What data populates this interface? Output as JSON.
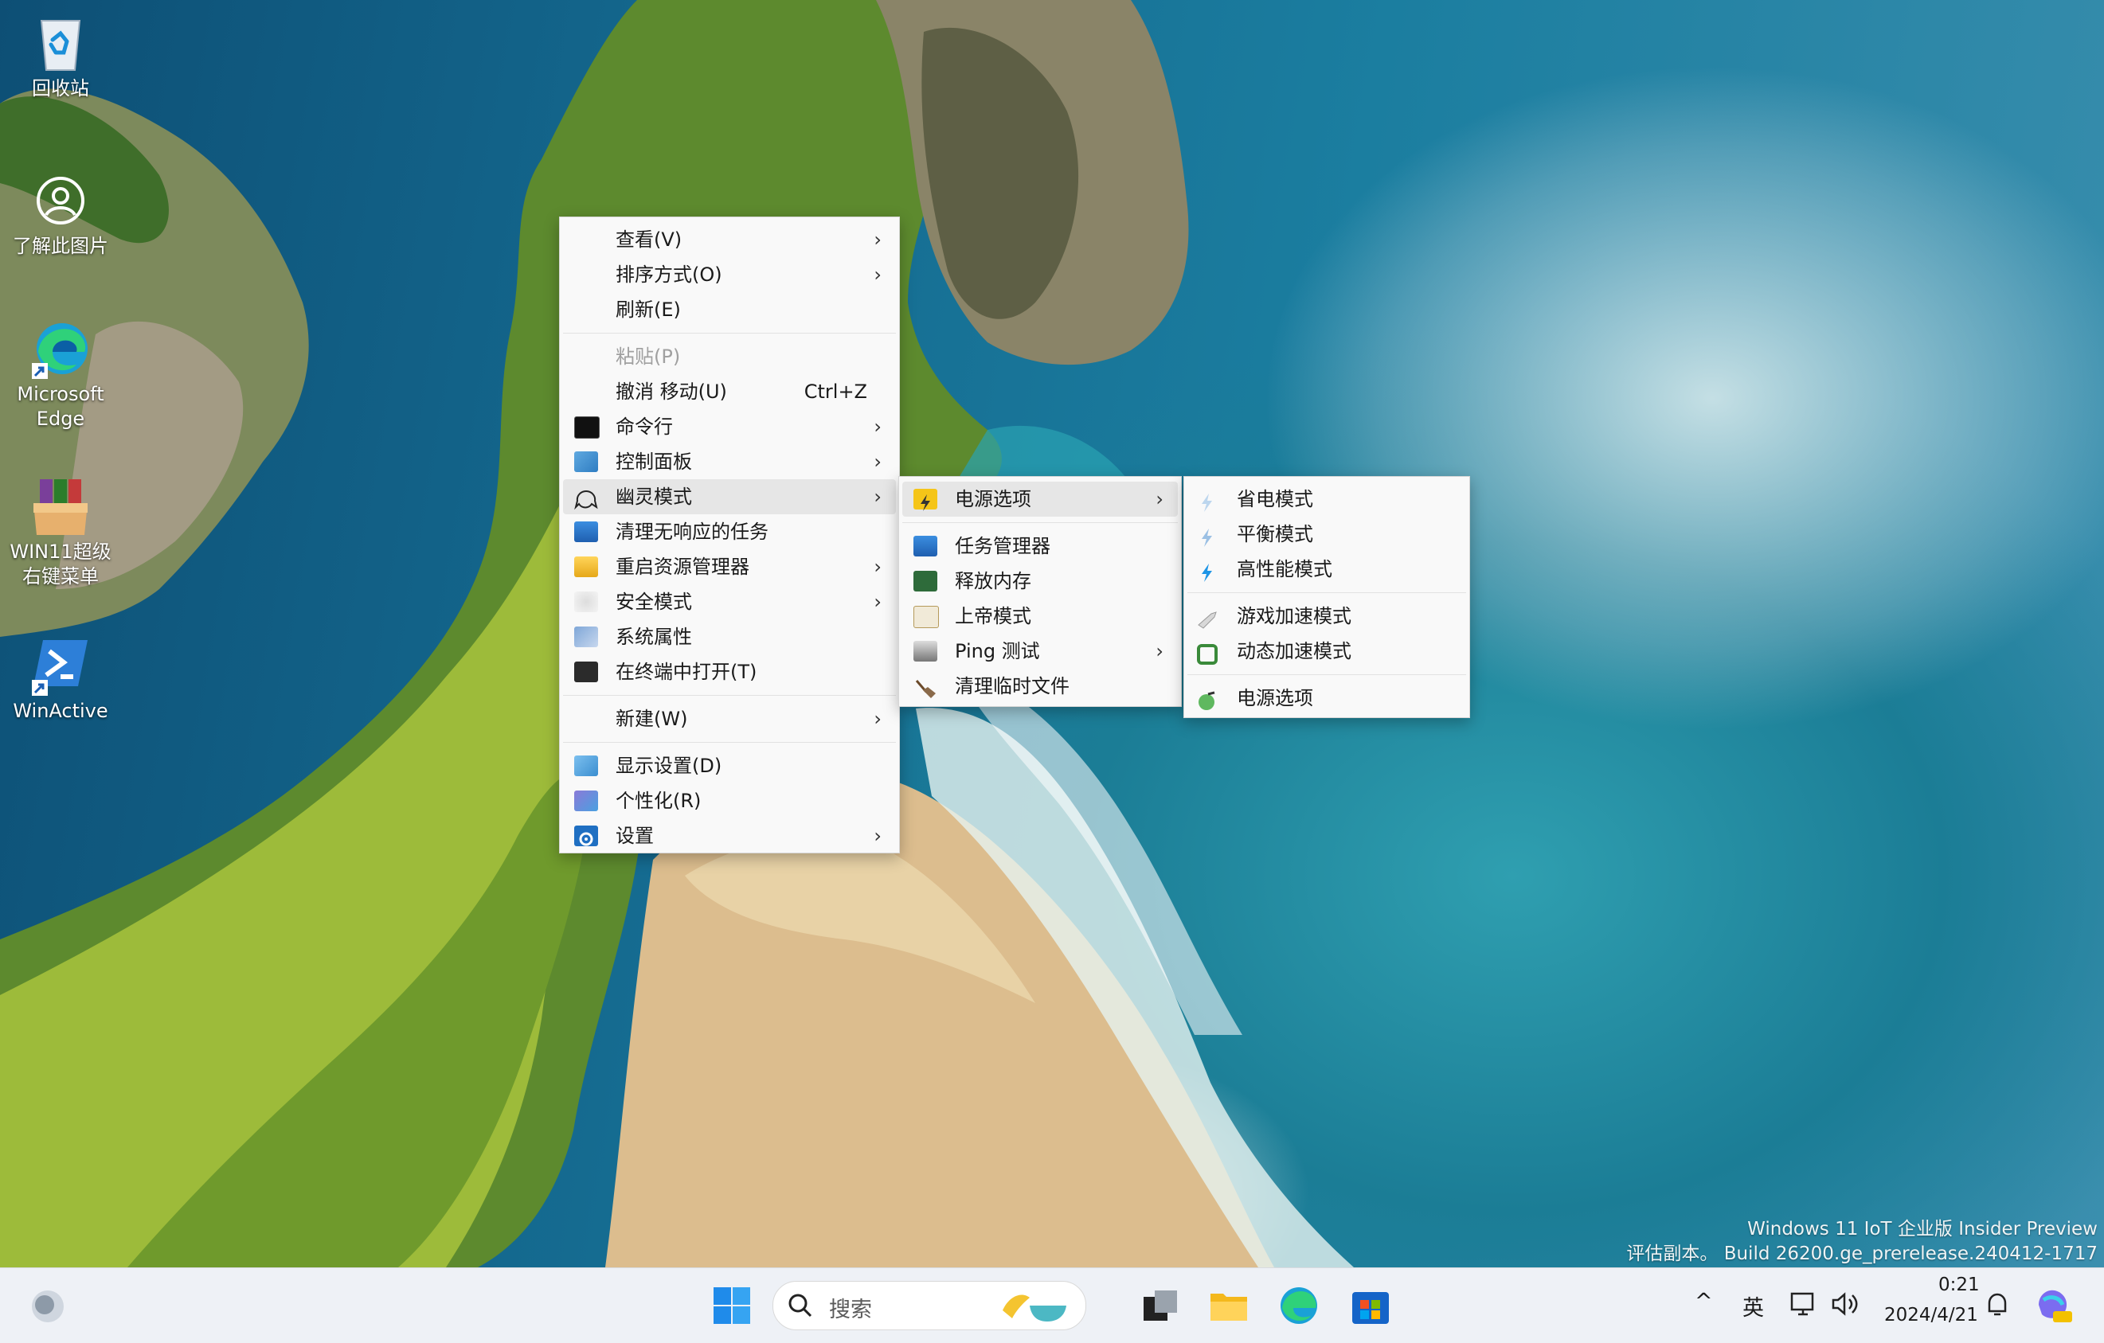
{
  "desktop_icons": [
    {
      "name": "recycle-bin",
      "label": "回收站",
      "icon": "recycle-bin-icon"
    },
    {
      "name": "learn-about-picture",
      "label": "了解此图片",
      "icon": "camera-icon"
    },
    {
      "name": "microsoft-edge",
      "label_line1": "Microsoft",
      "label_line2": "Edge",
      "icon": "edge-icon"
    },
    {
      "name": "win11-context-menu",
      "label_line1": "WIN11超级",
      "label_line2": "右键菜单",
      "icon": "winrar-box-icon"
    },
    {
      "name": "winactive",
      "label": "WinActive",
      "icon": "powershell-icon"
    }
  ],
  "context_menu": {
    "view": "查看(V)",
    "sort": "排序方式(O)",
    "refresh": "刷新(E)",
    "paste": "粘贴(P)",
    "undo": "撤消 移动(U)",
    "undo_shortcut": "Ctrl+Z",
    "cmd": "命令行",
    "control_panel": "控制面板",
    "ghost_mode": "幽灵模式",
    "clear_tasks": "清理无响应的任务",
    "restart_explorer": "重启资源管理器",
    "safe_mode": "安全模式",
    "system_props": "系统属性",
    "open_terminal": "在终端中打开(T)",
    "new": "新建(W)",
    "display_settings": "显示设置(D)",
    "personalize": "个性化(R)",
    "settings": "设置",
    "chevron": "›"
  },
  "submenu_ghost": {
    "power_options": "电源选项",
    "task_manager": "任务管理器",
    "free_memory": "释放内存",
    "god_mode": "上帝模式",
    "ping_test": "Ping 测试",
    "clean_temp": "清理临时文件"
  },
  "submenu_power": {
    "power_saver": "省电模式",
    "balanced": "平衡模式",
    "high_performance": "高性能模式",
    "game_boost": "游戏加速模式",
    "dynamic_boost": "动态加速模式",
    "power_options": "电源选项"
  },
  "watermark": {
    "line1": "Windows 11 IoT 企业版 Insider Preview",
    "line2": "评估副本。 Build 26200.ge_prerelease.240412-1717"
  },
  "taskbar": {
    "search_placeholder": "搜索",
    "ime": "英",
    "time": "0:21",
    "date": "2024/4/21",
    "chevron_up": "^"
  },
  "colors": {
    "accent": "#0067c0",
    "menu_bg": "#f9f9f9",
    "menu_highlight": "#e6e6e6"
  }
}
